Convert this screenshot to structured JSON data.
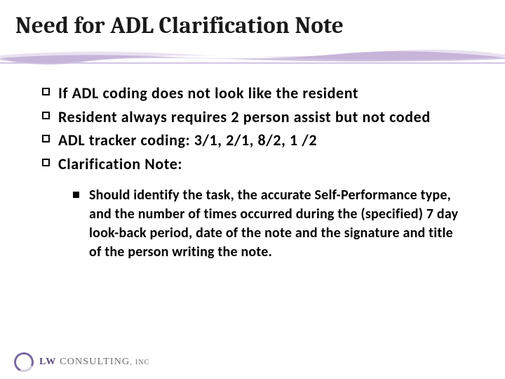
{
  "title": "Need for ADL Clarification Note",
  "bullets": [
    "If ADL coding does not look like the resident",
    "Resident always requires 2 person assist but not coded",
    "ADL tracker coding: 3/1, 2/1, 8/2, 1 /2",
    "Clarification Note:"
  ],
  "subbullets": [
    "Should identify the task, the accurate Self-Performance type, and the number of times occurred during the (specified) 7 day look-back period, date of the note and the signature and title of the person writing the note."
  ],
  "footer": {
    "company_lw": "LW",
    "company_rest": " CONSULTING",
    "company_inc": ", INC"
  },
  "colors": {
    "accent": "#7a6a9e"
  }
}
